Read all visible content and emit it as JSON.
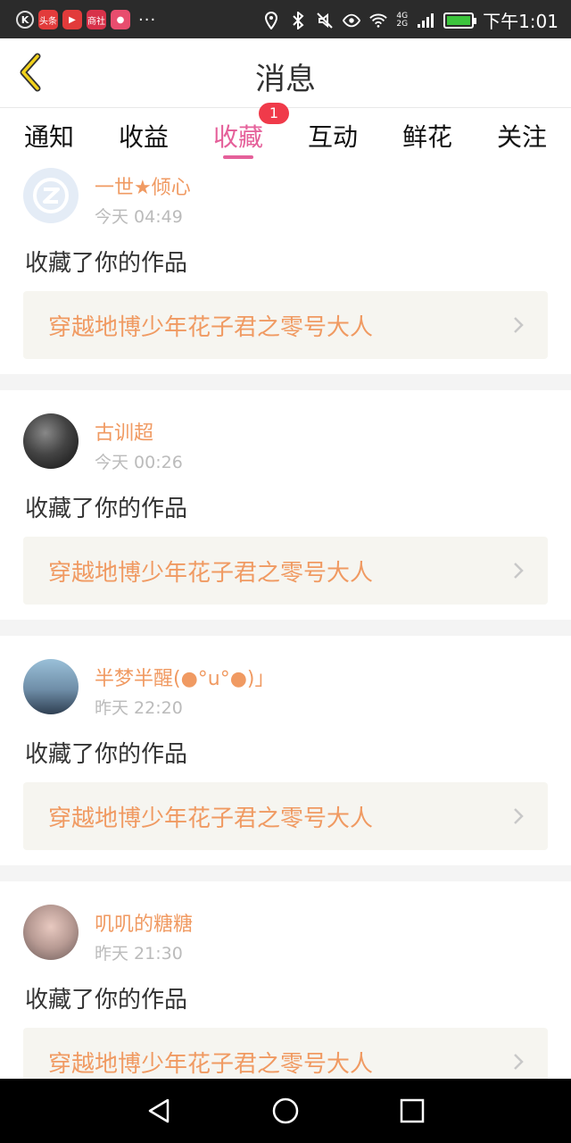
{
  "status_bar": {
    "clock": "下午1:01",
    "net_top": "4G",
    "net_bottom": "2G",
    "app_icons": [
      "k-app-icon",
      "toutiao-icon",
      "video-icon",
      "shop-icon",
      "chat-icon"
    ],
    "more": "···",
    "toutiao_label": "头条",
    "shop_label": "商社"
  },
  "header": {
    "title": "消息"
  },
  "tabs": [
    {
      "label": "通知"
    },
    {
      "label": "收益"
    },
    {
      "label": "收藏",
      "badge": "1"
    },
    {
      "label": "互动"
    },
    {
      "label": "鲜花"
    },
    {
      "label": "关注"
    }
  ],
  "feed": [
    {
      "name": "一世★倾心",
      "time": "今天 04:49",
      "action": "收藏了你的作品",
      "work": "穿越地博少年花子君之零号大人"
    },
    {
      "name": "古训超",
      "time": "今天 00:26",
      "action": "收藏了你的作品",
      "work": "穿越地博少年花子君之零号大人"
    },
    {
      "name": "半梦半醒(●°u°●)」",
      "time": "昨天 22:20",
      "action": "收藏了你的作品",
      "work": "穿越地博少年花子君之零号大人"
    },
    {
      "name": "叽叽的糖糖",
      "time": "昨天 21:30",
      "action": "收藏了你的作品",
      "work": "穿越地博少年花子君之零号大人"
    }
  ],
  "colors": {
    "accent": "#e5609a",
    "name": "#f09a62",
    "badge": "#f03a4a"
  }
}
